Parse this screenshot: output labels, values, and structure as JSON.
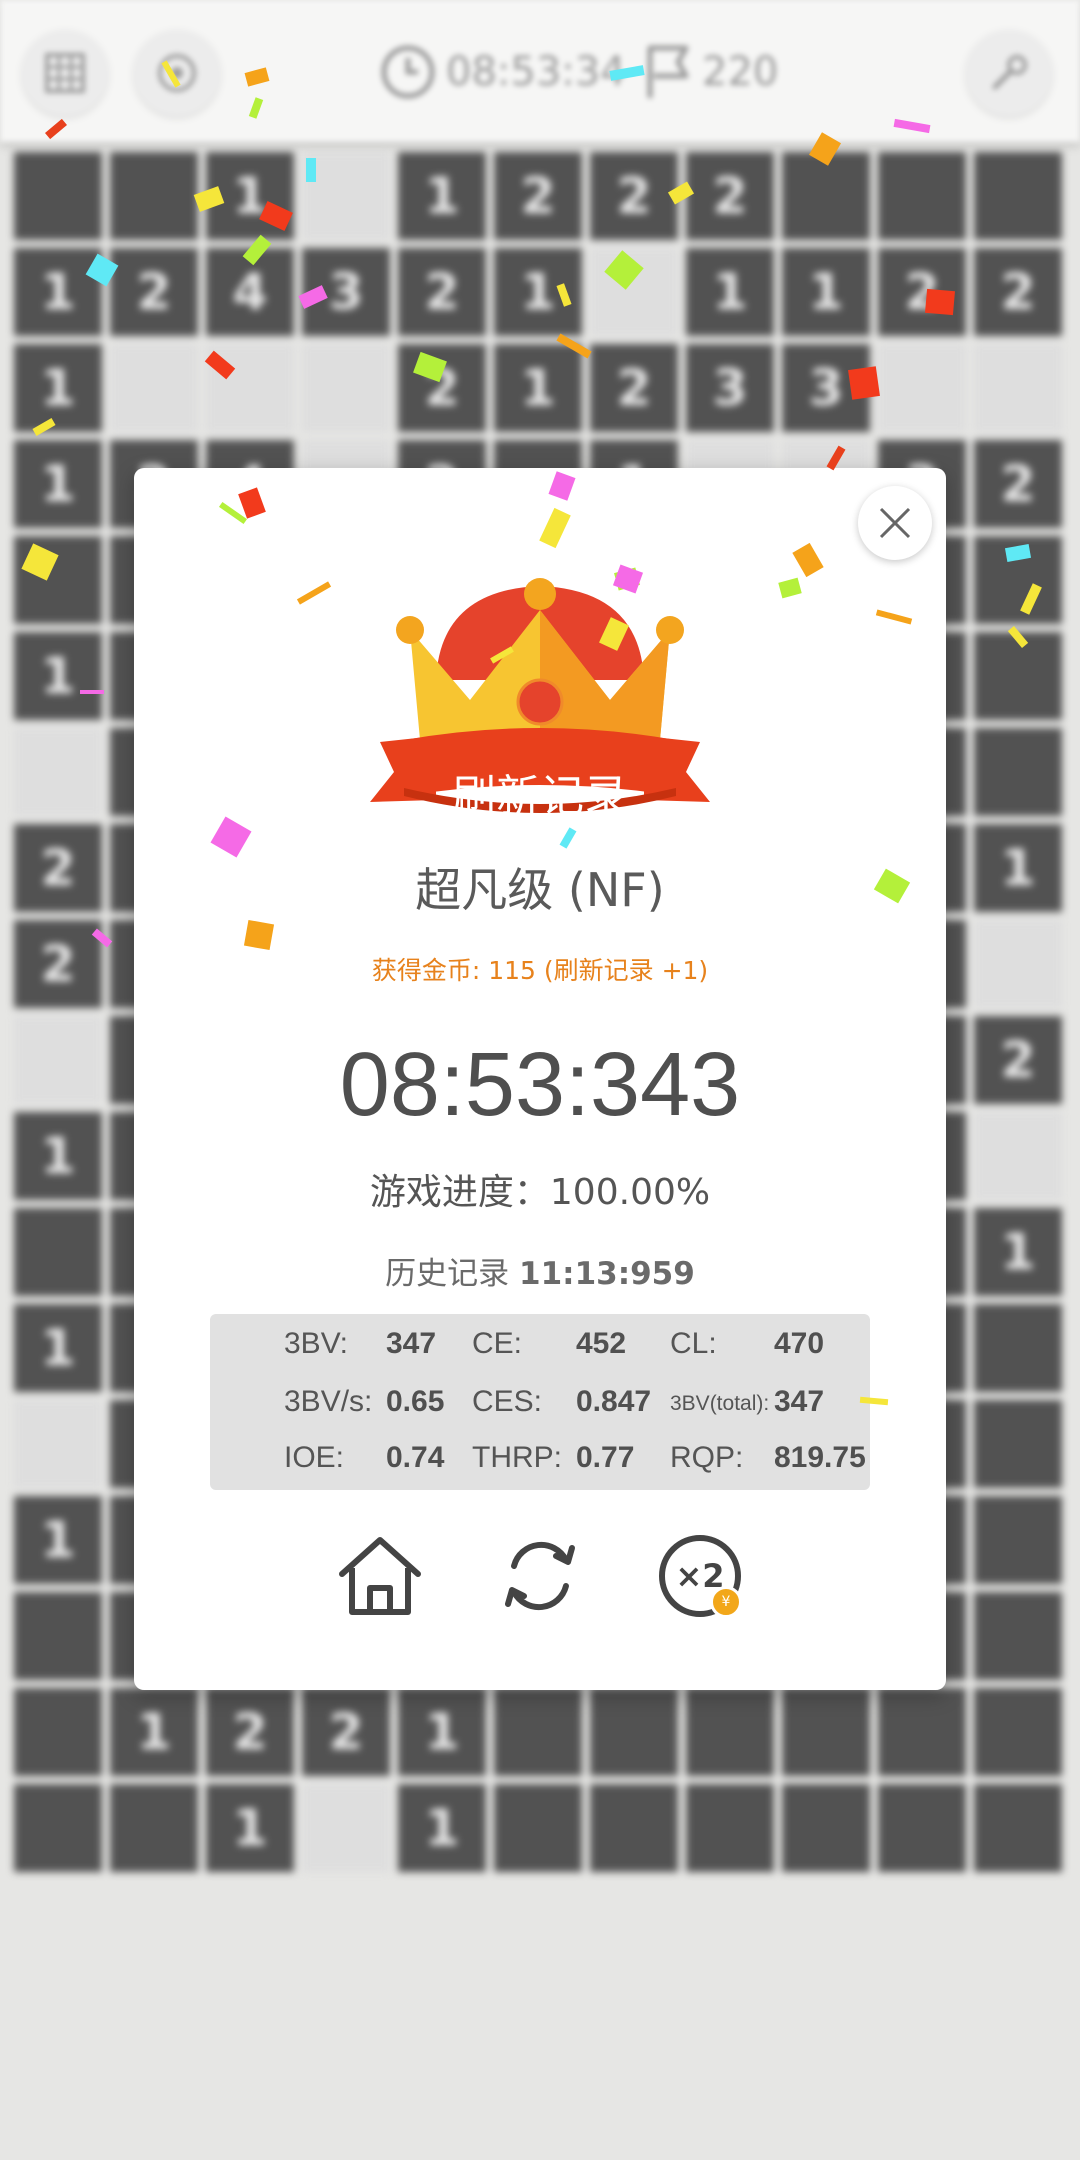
{
  "topbar": {
    "timer": "08:53:34",
    "flags": "220",
    "menu_icon": "grid-icon",
    "hint_icon": "hint-icon",
    "settings_icon": "tool-icon"
  },
  "board": {
    "rows": [
      [
        "",
        "",
        "1",
        "",
        "1",
        "2",
        "2",
        "2",
        "",
        "",
        ""
      ],
      [
        "1",
        "2",
        "4",
        "3",
        "2",
        "1",
        "",
        "1",
        "1",
        "2",
        "2"
      ],
      [
        "1",
        "",
        "",
        "",
        "2",
        "1",
        "2",
        "3",
        "3",
        "",
        ""
      ],
      [
        "1",
        "2",
        "4",
        "",
        "2",
        "",
        "1",
        "",
        "",
        "3",
        "2"
      ],
      [
        "",
        "",
        "",
        "",
        "",
        "",
        "",
        "",
        "",
        "",
        ""
      ],
      [
        "1",
        "",
        "",
        "",
        "",
        "",
        "",
        "",
        "",
        "",
        ""
      ],
      [
        "",
        "",
        "",
        "",
        "",
        "",
        "",
        "",
        "",
        "",
        ""
      ],
      [
        "2",
        "",
        "",
        "",
        "",
        "",
        "",
        "",
        "",
        "",
        "1"
      ],
      [
        "2",
        "",
        "",
        "",
        "",
        "",
        "",
        "",
        "",
        "",
        ""
      ],
      [
        "",
        "",
        "",
        "",
        "",
        "",
        "",
        "",
        "",
        "",
        "2"
      ],
      [
        "1",
        "",
        "",
        "",
        "",
        "",
        "",
        "",
        "",
        "",
        ""
      ],
      [
        "",
        "",
        "",
        "",
        "",
        "",
        "",
        "",
        "",
        "",
        "1"
      ],
      [
        "1",
        "",
        "",
        "",
        "",
        "",
        "",
        "",
        "",
        "",
        ""
      ],
      [
        "",
        "",
        "",
        "",
        "",
        "",
        "",
        "",
        "",
        "",
        ""
      ],
      [
        "1",
        "",
        "",
        "",
        "",
        "",
        "",
        "",
        "",
        "",
        ""
      ],
      [
        "",
        "",
        "",
        "",
        "",
        "",
        "",
        "",
        "",
        "",
        ""
      ],
      [
        "",
        "1",
        "2",
        "2",
        "1",
        "",
        "",
        "",
        "",
        "",
        ""
      ],
      [
        "",
        "",
        "1",
        "",
        "1",
        "",
        "",
        "",
        "",
        "",
        ""
      ]
    ],
    "open_cells": [
      [
        0,
        3
      ],
      [
        1,
        6
      ],
      [
        2,
        1
      ],
      [
        2,
        2
      ],
      [
        2,
        3
      ],
      [
        2,
        9
      ],
      [
        2,
        10
      ],
      [
        3,
        3
      ],
      [
        3,
        7
      ],
      [
        3,
        8
      ],
      [
        6,
        0
      ],
      [
        8,
        10
      ],
      [
        9,
        0
      ],
      [
        10,
        10
      ],
      [
        13,
        0
      ],
      [
        17,
        3
      ]
    ]
  },
  "dialog": {
    "ribbon_text": "刷新记录",
    "difficulty": "超凡级 (NF)",
    "coins": "获得金币: 115 (刷新记录 +1)",
    "time": "08:53:343",
    "progress": "游戏进度：100.00%",
    "history_label": "历史记录",
    "history_value": "11:13:959",
    "stats": {
      "bv_label": "3BV:",
      "bv": "347",
      "ce_label": "CE:",
      "ce": "452",
      "cl_label": "CL:",
      "cl": "470",
      "bvs_label": "3BV/s:",
      "bvs": "0.65",
      "ces_label": "CES:",
      "ces": "0.847",
      "bvt_label": "3BV(total):",
      "bvt": "347",
      "ioe_label": "IOE:",
      "ioe": "0.74",
      "thrp_label": "THRP:",
      "thrp": "0.77",
      "rqp_label": "RQP:",
      "rqp": "819.75"
    },
    "coin_symbol": "¥",
    "icons": {
      "close": "close-icon",
      "home": "home-icon",
      "restart": "refresh-icon",
      "double": "double-reward-icon"
    }
  },
  "colors": {
    "crown_gold": "#f5b32a",
    "ribbon_red": "#e8401c",
    "coin_orange": "#e7821c",
    "closed_cell": "#525252"
  }
}
